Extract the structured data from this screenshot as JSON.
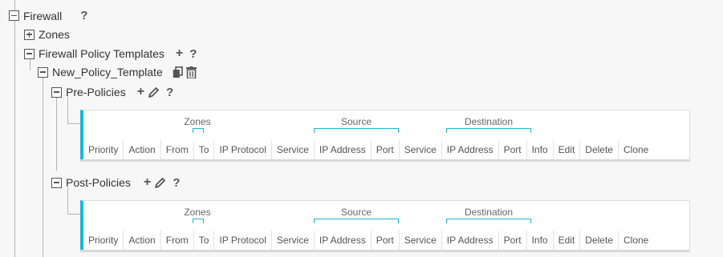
{
  "tree": {
    "firewall": {
      "label": "Firewall",
      "help": "?"
    },
    "zones": {
      "label": "Zones"
    },
    "policy_templates": {
      "label": "Firewall Policy Templates",
      "add": "+",
      "help": "?"
    },
    "template": {
      "label": "New_Policy_Template"
    },
    "pre_policies": {
      "label": "Pre-Policies",
      "add": "+",
      "help": "?",
      "groups": {
        "zones": "Zones",
        "source": "Source",
        "destination": "Destination"
      },
      "columns": [
        "Priority",
        "Action",
        "From",
        "To",
        "IP Protocol",
        "Service",
        "IP Address",
        "Port",
        "Service",
        "IP Address",
        "Port",
        "Info",
        "Edit",
        "Delete",
        "Clone"
      ]
    },
    "post_policies": {
      "label": "Post-Policies",
      "add": "+",
      "help": "?",
      "groups": {
        "zones": "Zones",
        "source": "Source",
        "destination": "Destination"
      },
      "columns": [
        "Priority",
        "Action",
        "From",
        "To",
        "IP Protocol",
        "Service",
        "IP Address",
        "Port",
        "Service",
        "IP Address",
        "Port",
        "Info",
        "Edit",
        "Delete",
        "Clone"
      ]
    }
  },
  "icons": {
    "copy": "copy-icon",
    "delete": "trash-icon",
    "edit": "pencil-icon"
  },
  "colors": {
    "accent": "#1fb5d8",
    "background": "#f7f7f7"
  }
}
